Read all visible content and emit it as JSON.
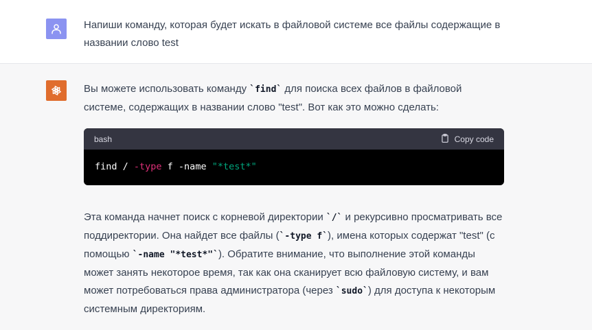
{
  "colors": {
    "user_avatar_bg": "#8b93f1",
    "assistant_avatar_bg": "#e06d2d",
    "code_header_bg": "#343541",
    "code_body_bg": "#000000",
    "string_token": "#00a67d",
    "flag_token": "#df3079"
  },
  "user_message": {
    "avatar_icon": "user-icon",
    "text": "Напиши команду, которая будет искать в файловой системе все файлы содержащие в названии слово test"
  },
  "assistant_message": {
    "avatar_icon": "openai-logo-icon",
    "intro": {
      "part1": "Вы можете использовать команду ",
      "code1": "`find`",
      "part2": " для поиска всех файлов в файловой системе, содержащих в названии слово \"test\". Вот как это можно сделать:"
    },
    "code_block": {
      "language": "bash",
      "copy_label": "Copy code",
      "copy_icon": "clipboard-icon",
      "tokens": {
        "t1": "find / ",
        "t2": "-type",
        "t3": " f -name ",
        "t4": "\"*test*\""
      }
    },
    "explanation": {
      "p1": "Эта команда начнет поиск с корневой директории ",
      "c1": "`/`",
      "p2": " и рекурсивно просматривать все поддиректории. Она найдет все файлы (",
      "c2": "`-type f`",
      "p3": "), имена которых содержат \"test\" (с помощью ",
      "c3": "`-name \"*test*\"`",
      "p4": "). Обратите внимание, что выполнение этой команды может занять некоторое время, так как она сканирует всю файловую систему, и вам может потребоваться права администратора (через ",
      "c4": "`sudo`",
      "p5": ") для доступа к некоторым системным директориям."
    }
  }
}
